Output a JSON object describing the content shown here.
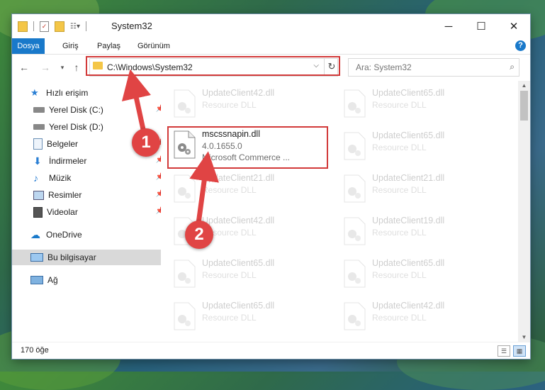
{
  "window": {
    "title": "System32"
  },
  "ribbon": {
    "tabs": [
      "Dosya",
      "Giriş",
      "Paylaş",
      "Görünüm"
    ],
    "help_label": "?"
  },
  "address": {
    "path": "C:\\Windows\\System32",
    "search_placeholder": "Ara: System32"
  },
  "sidebar": {
    "items": [
      {
        "label": "Hızlı erişim",
        "icon": "star-icon"
      },
      {
        "label": "Yerel Disk (C:)",
        "icon": "drive-icon"
      },
      {
        "label": "Yerel Disk (D:)",
        "icon": "drive-icon"
      },
      {
        "label": "Belgeler",
        "icon": "documents-icon"
      },
      {
        "label": "İndirmeler",
        "icon": "download-icon"
      },
      {
        "label": "Müzik",
        "icon": "music-icon"
      },
      {
        "label": "Resimler",
        "icon": "pictures-icon"
      },
      {
        "label": "Videolar",
        "icon": "videos-icon"
      },
      {
        "label": "OneDrive",
        "icon": "cloud-icon"
      },
      {
        "label": "Bu bilgisayar",
        "icon": "computer-icon"
      },
      {
        "label": "Ağ",
        "icon": "network-icon"
      }
    ]
  },
  "files": {
    "left_column": [
      {
        "name": "UpdateClient42.dll",
        "sub": "Resource DLL"
      },
      {
        "name": "mscssnapin.dll",
        "sub": "4.0.1655.0",
        "sub2": "Microsoft Commerce ..."
      },
      {
        "name": "UpdateClient21.dll",
        "sub": "Resource DLL"
      },
      {
        "name": "UpdateClient42.dll",
        "sub": "Resource DLL"
      },
      {
        "name": "UpdateClient65.dll",
        "sub": "Resource DLL"
      },
      {
        "name": "UpdateClient65.dll",
        "sub": "Resource DLL"
      }
    ],
    "right_column": [
      {
        "name": "UpdateClient65.dll",
        "sub": "Resource DLL"
      },
      {
        "name": "UpdateClient65.dll",
        "sub": "Resource DLL"
      },
      {
        "name": "UpdateClient21.dll",
        "sub": "Resource DLL"
      },
      {
        "name": "UpdateClient19.dll",
        "sub": "Resource DLL"
      },
      {
        "name": "UpdateClient65.dll",
        "sub": "Resource DLL"
      },
      {
        "name": "UpdateClient42.dll",
        "sub": "Resource DLL"
      }
    ]
  },
  "status": {
    "item_count": "170 öğe"
  },
  "annotations": {
    "step1": "1",
    "step2": "2",
    "color": "#e04444"
  }
}
